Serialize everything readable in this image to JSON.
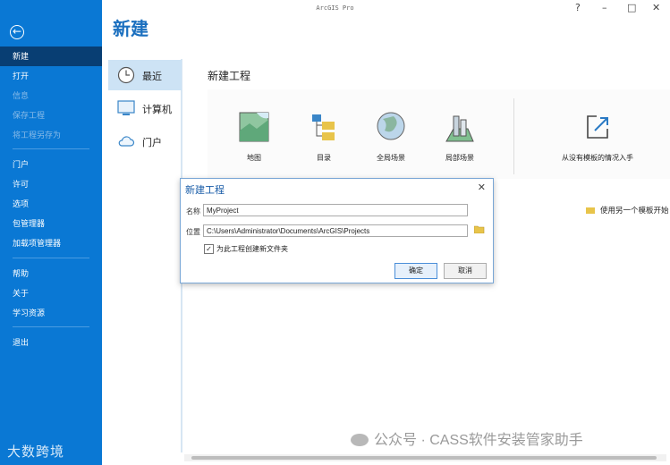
{
  "window": {
    "title": "ArcGIS Pro",
    "help": "?",
    "minimize": "–",
    "maximize": "□",
    "close": "✕"
  },
  "page_title": "新建",
  "sidebar": {
    "back": "←",
    "items": [
      {
        "label": "新建"
      },
      {
        "label": "打开"
      },
      {
        "label": "信息"
      },
      {
        "label": "保存工程"
      },
      {
        "label": "将工程另存为"
      },
      {
        "label": "门户"
      },
      {
        "label": "许可"
      },
      {
        "label": "选项"
      },
      {
        "label": "包管理器"
      },
      {
        "label": "加载项管理器"
      },
      {
        "label": "帮助"
      },
      {
        "label": "关于"
      },
      {
        "label": "学习资源"
      },
      {
        "label": "退出"
      }
    ],
    "watermark": "大数跨境"
  },
  "midnav": {
    "items": [
      {
        "label": "最近"
      },
      {
        "label": "计算机"
      },
      {
        "label": "门户"
      }
    ]
  },
  "content": {
    "section_title": "新建工程",
    "templates": [
      {
        "label": "地图"
      },
      {
        "label": "目录"
      },
      {
        "label": "全局场景"
      },
      {
        "label": "局部场景"
      }
    ],
    "blank": "从没有模板的情况入手",
    "other_template": "使用另一个模板开始"
  },
  "dialog": {
    "title": "新建工程",
    "name_label": "名称",
    "name_value": "MyProject",
    "location_label": "位置",
    "location_value": "C:\\Users\\Administrator\\Documents\\ArcGIS\\Projects",
    "checkbox_label": "为此工程创建新文件夹",
    "checkbox_mark": "✓",
    "ok": "确定",
    "cancel": "取消",
    "close": "✕"
  },
  "watermark_right": "公众号 · CASS软件安装管家助手",
  "colors": {
    "sidebar": "#0a78d4",
    "active": "#083e73",
    "accent": "#1a6fbf"
  }
}
